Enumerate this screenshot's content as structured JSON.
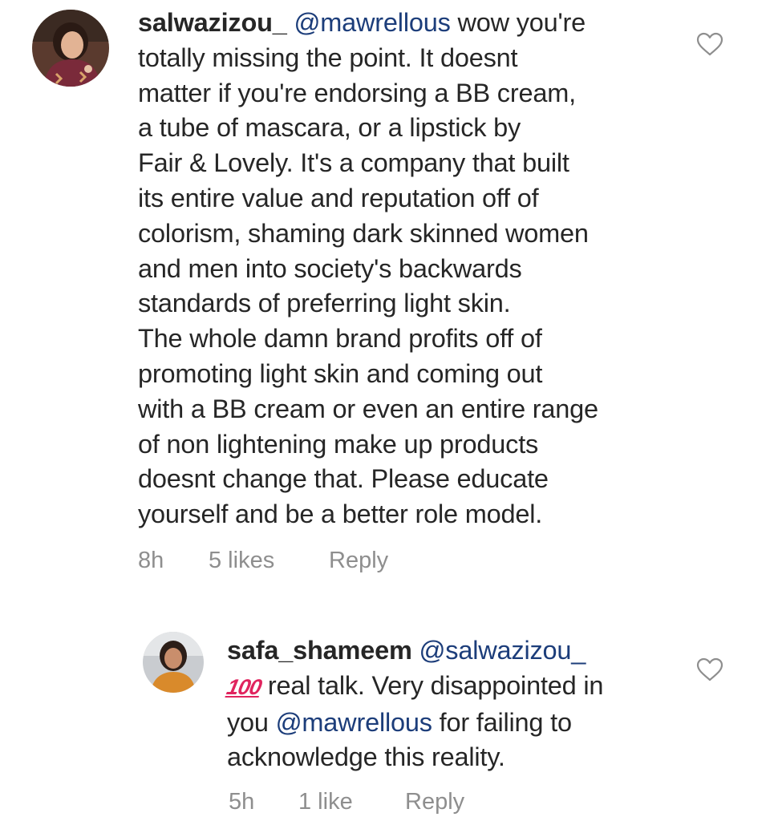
{
  "comments": [
    {
      "username": "salwazizou_",
      "mention": "@mawrellous",
      "text_after_mention": " wow you're\ntotally missing the point. It doesnt\nmatter if you're endorsing a BB cream,\na tube of mascara, or a lipstick by\nFair & Lovely. It's a company that built\nits entire value and reputation off of\ncolorism, shaming dark skinned women\nand men into society's backwards\nstandards of preferring light skin.\nThe whole damn brand profits off of\npromoting light skin and coming out\nwith a BB cream or even an entire range\nof non lightening make up products\ndoesnt change that. Please educate\nyourself and be a better role model.",
      "time": "8h",
      "likes": "5 likes",
      "reply_label": "Reply",
      "like_icon": "heart-outline-icon"
    },
    {
      "username": "safa_shameem",
      "mention": "@salwazizou_",
      "emoji": "100",
      "text_before_mention2": " real talk. Very disappointed in\nyou ",
      "mention2": "@mawrellous",
      "text_after_mention2": " for failing to\nacknowledge this reality.",
      "time": "5h",
      "likes": "1 like",
      "reply_label": "Reply",
      "like_icon": "heart-outline-icon"
    }
  ],
  "colors": {
    "text": "#262626",
    "mention": "#1c3d7a",
    "meta": "#8e8e8e",
    "emoji": "#e0245e"
  }
}
